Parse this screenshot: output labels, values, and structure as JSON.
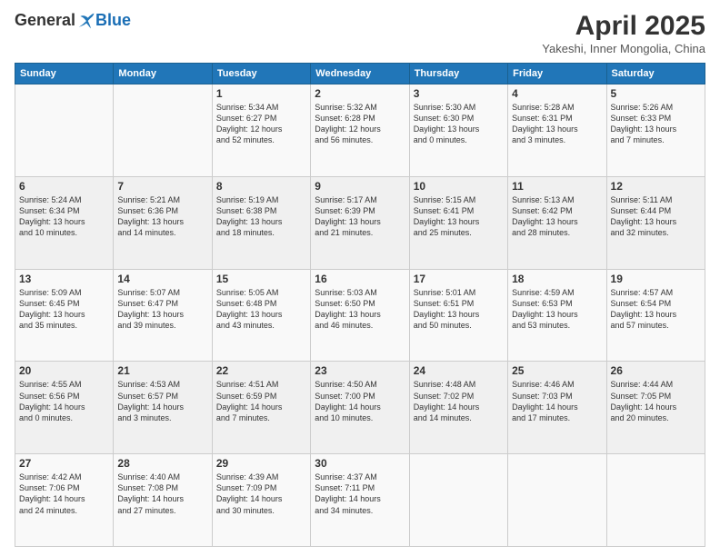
{
  "logo": {
    "general": "General",
    "blue": "Blue"
  },
  "header": {
    "title": "April 2025",
    "subtitle": "Yakeshi, Inner Mongolia, China"
  },
  "days_of_week": [
    "Sunday",
    "Monday",
    "Tuesday",
    "Wednesday",
    "Thursday",
    "Friday",
    "Saturday"
  ],
  "weeks": [
    [
      {
        "day": "",
        "info": ""
      },
      {
        "day": "",
        "info": ""
      },
      {
        "day": "1",
        "info": "Sunrise: 5:34 AM\nSunset: 6:27 PM\nDaylight: 12 hours\nand 52 minutes."
      },
      {
        "day": "2",
        "info": "Sunrise: 5:32 AM\nSunset: 6:28 PM\nDaylight: 12 hours\nand 56 minutes."
      },
      {
        "day": "3",
        "info": "Sunrise: 5:30 AM\nSunset: 6:30 PM\nDaylight: 13 hours\nand 0 minutes."
      },
      {
        "day": "4",
        "info": "Sunrise: 5:28 AM\nSunset: 6:31 PM\nDaylight: 13 hours\nand 3 minutes."
      },
      {
        "day": "5",
        "info": "Sunrise: 5:26 AM\nSunset: 6:33 PM\nDaylight: 13 hours\nand 7 minutes."
      }
    ],
    [
      {
        "day": "6",
        "info": "Sunrise: 5:24 AM\nSunset: 6:34 PM\nDaylight: 13 hours\nand 10 minutes."
      },
      {
        "day": "7",
        "info": "Sunrise: 5:21 AM\nSunset: 6:36 PM\nDaylight: 13 hours\nand 14 minutes."
      },
      {
        "day": "8",
        "info": "Sunrise: 5:19 AM\nSunset: 6:38 PM\nDaylight: 13 hours\nand 18 minutes."
      },
      {
        "day": "9",
        "info": "Sunrise: 5:17 AM\nSunset: 6:39 PM\nDaylight: 13 hours\nand 21 minutes."
      },
      {
        "day": "10",
        "info": "Sunrise: 5:15 AM\nSunset: 6:41 PM\nDaylight: 13 hours\nand 25 minutes."
      },
      {
        "day": "11",
        "info": "Sunrise: 5:13 AM\nSunset: 6:42 PM\nDaylight: 13 hours\nand 28 minutes."
      },
      {
        "day": "12",
        "info": "Sunrise: 5:11 AM\nSunset: 6:44 PM\nDaylight: 13 hours\nand 32 minutes."
      }
    ],
    [
      {
        "day": "13",
        "info": "Sunrise: 5:09 AM\nSunset: 6:45 PM\nDaylight: 13 hours\nand 35 minutes."
      },
      {
        "day": "14",
        "info": "Sunrise: 5:07 AM\nSunset: 6:47 PM\nDaylight: 13 hours\nand 39 minutes."
      },
      {
        "day": "15",
        "info": "Sunrise: 5:05 AM\nSunset: 6:48 PM\nDaylight: 13 hours\nand 43 minutes."
      },
      {
        "day": "16",
        "info": "Sunrise: 5:03 AM\nSunset: 6:50 PM\nDaylight: 13 hours\nand 46 minutes."
      },
      {
        "day": "17",
        "info": "Sunrise: 5:01 AM\nSunset: 6:51 PM\nDaylight: 13 hours\nand 50 minutes."
      },
      {
        "day": "18",
        "info": "Sunrise: 4:59 AM\nSunset: 6:53 PM\nDaylight: 13 hours\nand 53 minutes."
      },
      {
        "day": "19",
        "info": "Sunrise: 4:57 AM\nSunset: 6:54 PM\nDaylight: 13 hours\nand 57 minutes."
      }
    ],
    [
      {
        "day": "20",
        "info": "Sunrise: 4:55 AM\nSunset: 6:56 PM\nDaylight: 14 hours\nand 0 minutes."
      },
      {
        "day": "21",
        "info": "Sunrise: 4:53 AM\nSunset: 6:57 PM\nDaylight: 14 hours\nand 3 minutes."
      },
      {
        "day": "22",
        "info": "Sunrise: 4:51 AM\nSunset: 6:59 PM\nDaylight: 14 hours\nand 7 minutes."
      },
      {
        "day": "23",
        "info": "Sunrise: 4:50 AM\nSunset: 7:00 PM\nDaylight: 14 hours\nand 10 minutes."
      },
      {
        "day": "24",
        "info": "Sunrise: 4:48 AM\nSunset: 7:02 PM\nDaylight: 14 hours\nand 14 minutes."
      },
      {
        "day": "25",
        "info": "Sunrise: 4:46 AM\nSunset: 7:03 PM\nDaylight: 14 hours\nand 17 minutes."
      },
      {
        "day": "26",
        "info": "Sunrise: 4:44 AM\nSunset: 7:05 PM\nDaylight: 14 hours\nand 20 minutes."
      }
    ],
    [
      {
        "day": "27",
        "info": "Sunrise: 4:42 AM\nSunset: 7:06 PM\nDaylight: 14 hours\nand 24 minutes."
      },
      {
        "day": "28",
        "info": "Sunrise: 4:40 AM\nSunset: 7:08 PM\nDaylight: 14 hours\nand 27 minutes."
      },
      {
        "day": "29",
        "info": "Sunrise: 4:39 AM\nSunset: 7:09 PM\nDaylight: 14 hours\nand 30 minutes."
      },
      {
        "day": "30",
        "info": "Sunrise: 4:37 AM\nSunset: 7:11 PM\nDaylight: 14 hours\nand 34 minutes."
      },
      {
        "day": "",
        "info": ""
      },
      {
        "day": "",
        "info": ""
      },
      {
        "day": "",
        "info": ""
      }
    ]
  ]
}
